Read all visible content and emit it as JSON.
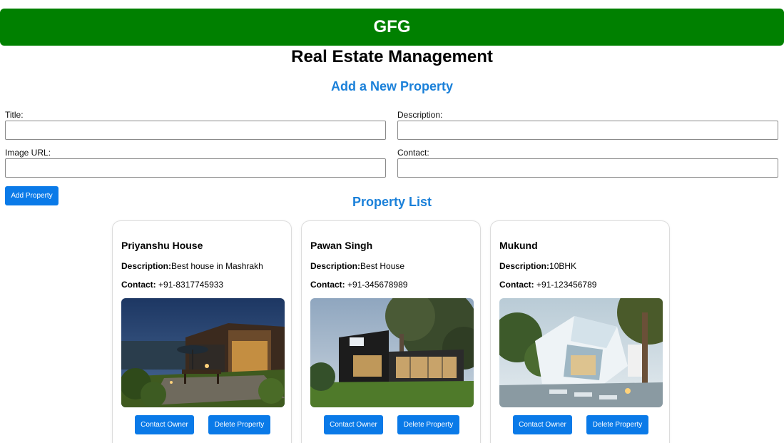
{
  "banner": {
    "title": "GFG"
  },
  "page_title": "Real Estate Management",
  "form": {
    "heading": "Add a New Property",
    "title_label": "Title:",
    "title_value": "",
    "description_label": "Description:",
    "description_value": "",
    "image_label": "Image URL:",
    "image_value": "",
    "contact_label": "Contact:",
    "contact_value": "",
    "submit_label": "Add Property"
  },
  "list": {
    "heading": "Property List",
    "description_label": "Description:",
    "contact_label": "Contact:",
    "contact_button": "Contact Owner",
    "delete_button": "Delete Property",
    "properties": [
      {
        "title": "Priyanshu House",
        "description": "Best house in Mashrakh",
        "contact": "+91-8317745933",
        "image": "house-night-patio"
      },
      {
        "title": "Pawan Singh",
        "description": "Best House",
        "contact": "+91-345678989",
        "image": "modern-house-tree"
      },
      {
        "title": "Mukund",
        "description": "10BHK",
        "contact": "+91-123456789",
        "image": "white-angular-house"
      }
    ]
  },
  "colors": {
    "banner": "#008000",
    "heading_blue": "#1a80d9",
    "button_blue": "#0a7ae8"
  }
}
